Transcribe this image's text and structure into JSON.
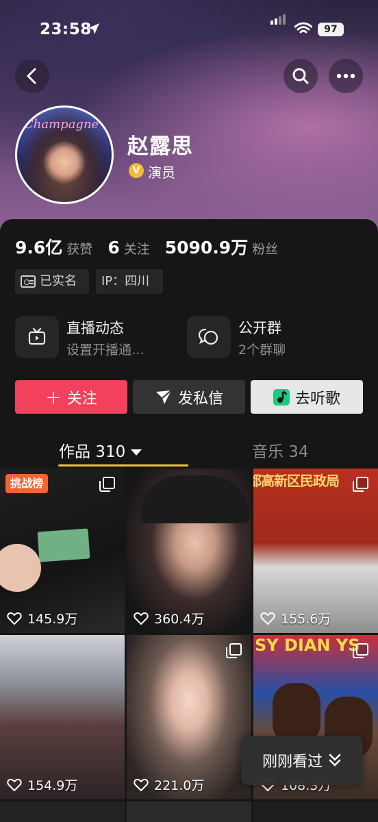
{
  "status_bar": {
    "time": "23:58",
    "battery": "97"
  },
  "profile": {
    "avatar_text": "Champagne",
    "name": "赵露思",
    "verification": "演员",
    "stats": [
      {
        "value": "9.6亿",
        "label": "获赞"
      },
      {
        "value": "6",
        "label": "关注"
      },
      {
        "value": "5090.9万",
        "label": "粉丝"
      }
    ],
    "tags": {
      "real_name": "已实名",
      "ip": "IP：四川"
    }
  },
  "features": [
    {
      "title": "直播动态",
      "subtitle": "设置开播通…",
      "icon": "tv-icon"
    },
    {
      "title": "公开群",
      "subtitle": "2个群聊",
      "icon": "chat-icon"
    }
  ],
  "actions": {
    "follow": "关注",
    "message": "发私信",
    "listen": "去听歌"
  },
  "tabs": {
    "works": "作品 310",
    "music": "音乐 34"
  },
  "videos": [
    {
      "likes": "145.9万",
      "badge": "挑战榜"
    },
    {
      "likes": "360.4万"
    },
    {
      "likes": "155.6万",
      "sign": "都高新区民政局"
    },
    {
      "likes": "154.9万"
    },
    {
      "likes": "221.0万"
    },
    {
      "likes": "108.3万",
      "sign": "SY DIAN YS"
    }
  ],
  "recent": "刚刚看过",
  "colors": {
    "accent": "#f2405d",
    "tab_underline": "#f4c23b",
    "badge": "#f26438"
  }
}
